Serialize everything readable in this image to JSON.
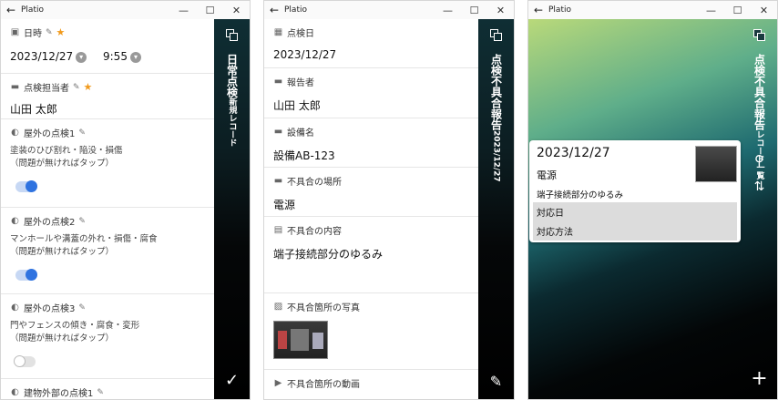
{
  "app_title": "Platio",
  "window_controls": {
    "minimize": "—",
    "maximize": "☐",
    "close": "✕"
  },
  "w1": {
    "side_title": "日常点検",
    "side_subtitle": "新規レコード",
    "fields": {
      "datetime_label": "日時",
      "date_value": "2023/12/27",
      "time_value": "9:55",
      "inspector_label": "点検担当者",
      "inspector_value": "山田 太郎",
      "check1_label": "屋外の点検1",
      "check1_desc_1": "塗装のひび割れ・陥没・損傷",
      "check1_desc_2": "（問題が無ければタップ）",
      "check2_label": "屋外の点検2",
      "check2_desc_1": "マンホールや溝蓋の外れ・損傷・腐食",
      "check2_desc_2": "（問題が無ければタップ）",
      "check3_label": "屋外の点検3",
      "check3_desc_1": "門やフェンスの傾き・腐食・変形",
      "check3_desc_2": "（問題が無ければタップ）",
      "building_label": "建物外部の点検1"
    },
    "toggles": {
      "check1": true,
      "check2": true,
      "check3": false
    }
  },
  "w2": {
    "side_title": "点検不具合報告",
    "side_subtitle": "2023/12/27",
    "fields": {
      "inspect_date_label": "点検日",
      "inspect_date_value": "2023/12/27",
      "reporter_label": "報告者",
      "reporter_value": "山田 太郎",
      "equipment_label": "設備名",
      "equipment_value": "設備AB-123",
      "location_label": "不具合の場所",
      "location_value": "電源",
      "content_label": "不具合の内容",
      "content_value": "端子接続部分のゆるみ",
      "photo_label": "不具合箇所の写真",
      "video_label": "不具合箇所の動画"
    }
  },
  "w3": {
    "side_title": "点検不具合報告",
    "side_subtitle": "レコード一覧",
    "card": {
      "date": "2023/12/27",
      "location": "電源",
      "content": "端子接続部分のゆるみ",
      "response_date_label": "対応日",
      "response_method_label": "対応方法"
    }
  },
  "icons": {
    "back": "back-arrow-icon",
    "stack": "layers-icon",
    "check": "checkmark-icon",
    "edit": "edit-icon",
    "search": "search-icon",
    "sort": "sort-icon",
    "add": "plus-icon"
  },
  "colors": {
    "accent": "#2f73e0",
    "required_star": "#f19a1c",
    "sidebar": "#0c1d21"
  }
}
